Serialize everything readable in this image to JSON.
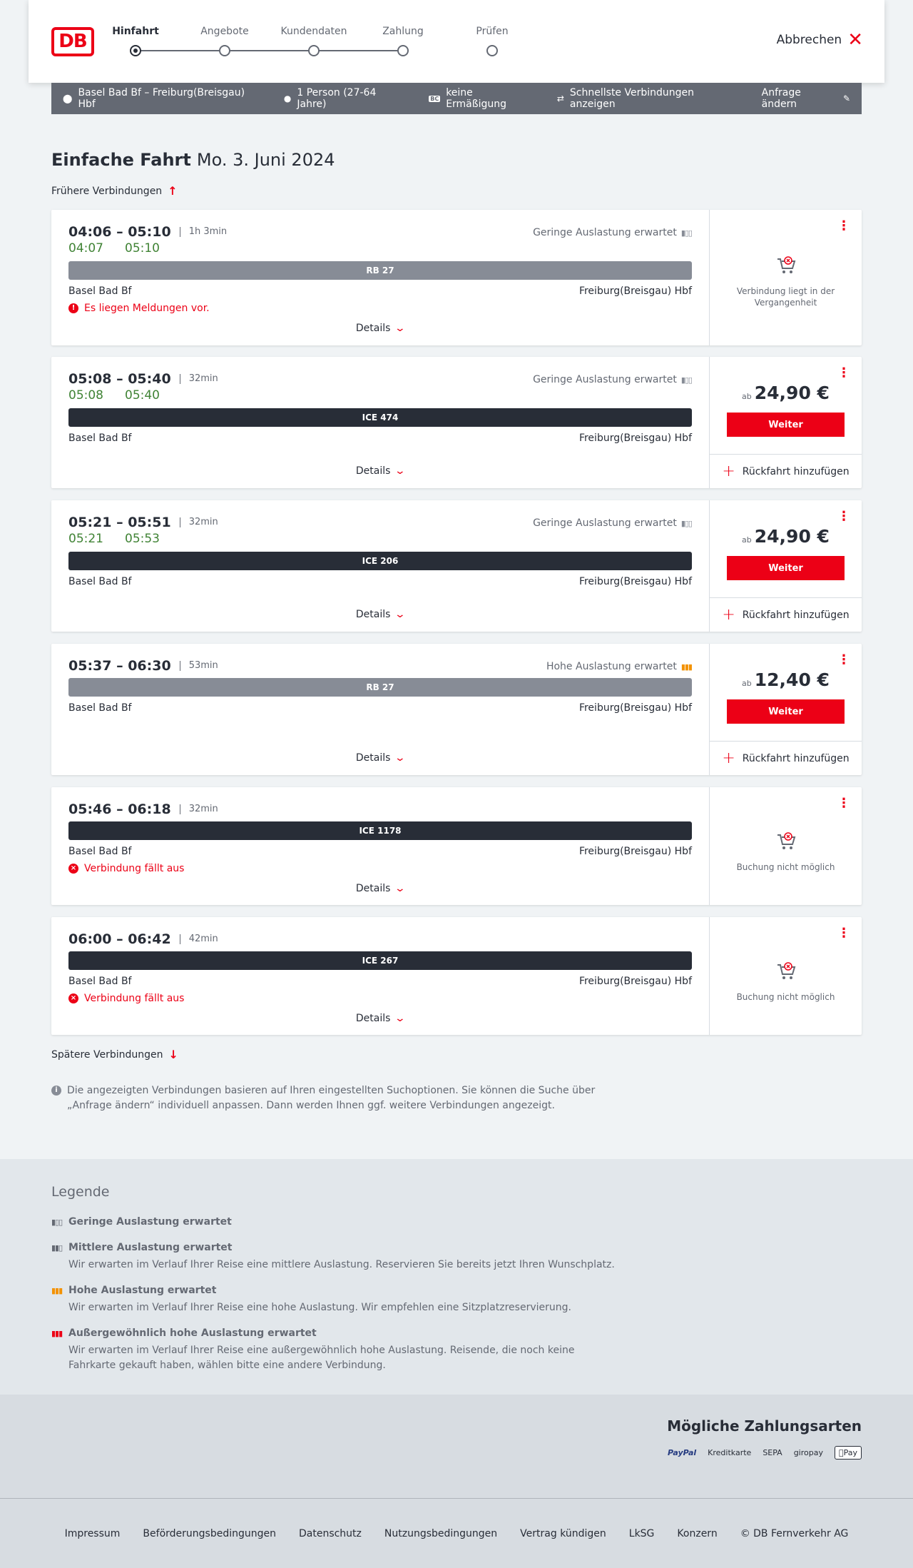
{
  "header": {
    "logo": "DB",
    "steps": [
      "Hinfahrt",
      "Angebote",
      "Kundendaten",
      "Zahlung",
      "Prüfen"
    ],
    "active_step": 0,
    "cancel_label": "Abbrechen"
  },
  "summary": {
    "route": "Basel Bad Bf – Freiburg(Breisgau) Hbf",
    "persons": "1 Person (27-64 Jahre)",
    "discount_icon": "BC",
    "discount": "keine Ermäßigung",
    "fastest": "Schnellste Verbindungen anzeigen",
    "edit": "Anfrage ändern"
  },
  "title": {
    "kind": "Einfache Fahrt",
    "date": "Mo. 3. Juni 2024"
  },
  "earlier": "Frühere Verbindungen",
  "later": "Spätere Verbindungen",
  "details_label": "Details",
  "weiter_label": "Weiter",
  "ret_label": "Rückfahrt hinzufügen",
  "connections": [
    {
      "times": "04:06 – 05:10",
      "dur": "1h 3min",
      "rt_dep": "04:07",
      "rt_arr": "05:10",
      "occ": "Geringe Auslastung erwartet",
      "train": "RB 27",
      "from": "Basel Bad Bf",
      "to": "Freiburg(Breisgau) Hbf",
      "msg": "Es liegen Meldungen vor.",
      "status": "Verbindung liegt in der Vergangenheit"
    },
    {
      "times": "05:08 – 05:40",
      "dur": "32min",
      "rt_dep": "05:08",
      "rt_arr": "05:40",
      "occ": "Geringe Auslastung erwartet",
      "train": "ICE 474",
      "from": "Basel Bad Bf",
      "to": "Freiburg(Breisgau) Hbf",
      "price_prefix": "ab",
      "price": "24,90 €"
    },
    {
      "times": "05:21 – 05:51",
      "dur": "32min",
      "rt_dep": "05:21",
      "rt_arr": "05:53",
      "occ": "Geringe Auslastung erwartet",
      "train": "ICE 206",
      "from": "Basel Bad Bf",
      "to": "Freiburg(Breisgau) Hbf",
      "price_prefix": "ab",
      "price": "24,90 €"
    },
    {
      "times": "05:37 – 06:30",
      "dur": "53min",
      "occ": "Hohe Auslastung erwartet",
      "train": "RB 27",
      "from": "Basel Bad Bf",
      "to": "Freiburg(Breisgau) Hbf",
      "price_prefix": "ab",
      "price": "12,40 €"
    },
    {
      "times": "05:46 – 06:18",
      "dur": "32min",
      "train": "ICE 1178",
      "from": "Basel Bad Bf",
      "to": "Freiburg(Breisgau) Hbf",
      "msg": "Verbindung fällt aus",
      "status": "Buchung nicht möglich"
    },
    {
      "times": "06:00 – 06:42",
      "dur": "42min",
      "train": "ICE 267",
      "from": "Basel Bad Bf",
      "to": "Freiburg(Breisgau) Hbf",
      "msg": "Verbindung fällt aus",
      "status": "Buchung nicht möglich"
    }
  ],
  "info": "Die angezeigten Verbindungen basieren auf Ihren eingestellten Suchoptionen. Sie können die Suche über „Anfrage ändern“ individuell anpassen. Dann werden Ihnen ggf. weitere Verbindungen angezeigt.",
  "legend": {
    "title": "Legende",
    "items": [
      {
        "t": "Geringe Auslastung erwartet"
      },
      {
        "t": "Mittlere Auslastung erwartet",
        "d": "Wir erwarten im Verlauf Ihrer Reise eine mittlere Auslastung. Reservieren Sie bereits jetzt Ihren Wunschplatz."
      },
      {
        "t": "Hohe Auslastung erwartet",
        "d": "Wir erwarten im Verlauf Ihrer Reise eine hohe Auslastung. Wir empfehlen eine Sitzplatzreservierung."
      },
      {
        "t": "Außergewöhnlich hohe Auslastung erwartet",
        "d": "Wir erwarten im Verlauf Ihrer Reise eine außergewöhnlich hohe Auslastung. Reisende, die noch keine Fahrkarte gekauft haben, wählen bitte eine andere Verbindung."
      }
    ]
  },
  "payment": {
    "title": "Mögliche Zahlungsarten",
    "methods": [
      "PayPal",
      "Kreditkarte",
      "SEPA",
      "giropay",
      "Pay"
    ]
  },
  "footer": [
    "Impressum",
    "Beförderungsbedingungen",
    "Datenschutz",
    "Nutzungsbedingungen",
    "Vertrag kündigen",
    "LkSG",
    "Konzern",
    "© DB Fernverkehr AG"
  ],
  "colors": {
    "accent": "#ec0016",
    "realtime": "#408335",
    "dark": "#282d37",
    "grey": "#646973"
  }
}
